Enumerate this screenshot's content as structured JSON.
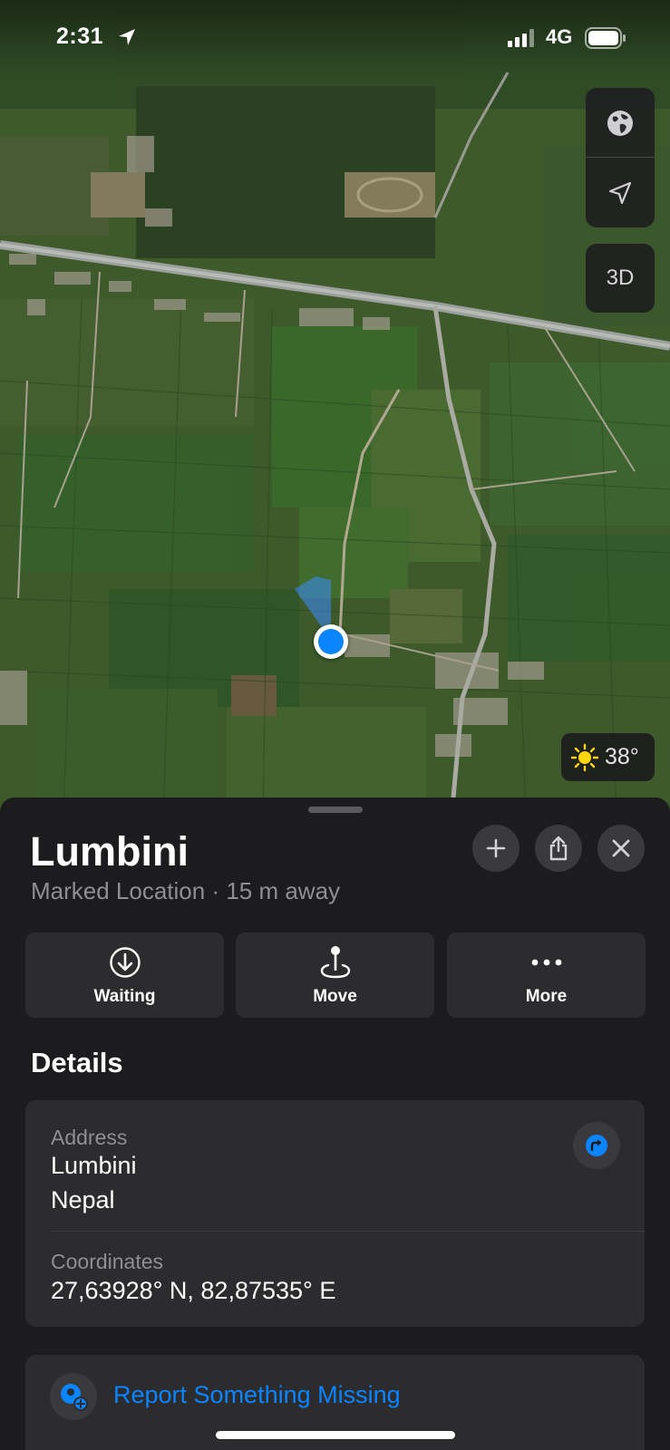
{
  "status_bar": {
    "time": "2:31",
    "network": "4G"
  },
  "map": {
    "controls": {
      "globe_icon": "globe-icon",
      "location_icon": "location-arrow-icon",
      "view_3d_label": "3D"
    },
    "weather": {
      "icon": "sun-icon",
      "temperature": "38°"
    },
    "colors": {
      "user_dot": "#0a84ff",
      "user_heading": "#3b8cff"
    }
  },
  "place": {
    "title": "Lumbini",
    "subtitle": "Marked Location · 15 m away"
  },
  "actions": [
    {
      "label": "Waiting",
      "icon": "arrow-down-circle-icon"
    },
    {
      "label": "Move",
      "icon": "pin-move-icon"
    },
    {
      "label": "More",
      "icon": "ellipsis-icon"
    }
  ],
  "details": {
    "heading": "Details",
    "address_label": "Address",
    "address_line1": "Lumbini",
    "address_line2": "Nepal",
    "coordinates_label": "Coordinates",
    "coordinates_value": "27,63928° N, 82,87535° E"
  },
  "report": {
    "label": "Report Something Missing"
  },
  "accent": "#0a84ff"
}
